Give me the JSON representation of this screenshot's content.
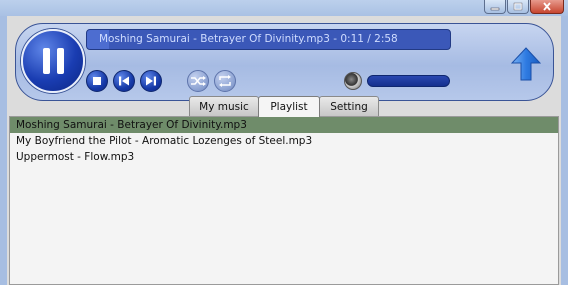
{
  "window": {
    "buttons": [
      "minimize",
      "maximize",
      "close"
    ]
  },
  "player": {
    "now_playing": "Moshing Samurai - Betrayer Of Divinity.mp3 - 0:11 / 2:58",
    "progress": 0.06,
    "state": "playing",
    "icons": {
      "play_pause": "pause-icon",
      "stop": "stop-icon",
      "previous": "previous-icon",
      "next": "next-icon",
      "shuffle": "shuffle-icon",
      "repeat": "repeat-icon",
      "volume": "volume-knob-icon",
      "collapse": "up-arrow-icon"
    },
    "volume": 1.0
  },
  "tabs": [
    {
      "label": "My music",
      "active": false
    },
    {
      "label": "Playlist",
      "active": true
    },
    {
      "label": "Setting",
      "active": false
    }
  ],
  "playlist": {
    "items": [
      {
        "label": "Moshing Samurai - Betrayer Of Divinity.mp3",
        "selected": true
      },
      {
        "label": "My Boyfriend the Pilot - Aromatic Lozenges of Steel.mp3",
        "selected": false
      },
      {
        "label": "Uppermost - Flow.mp3",
        "selected": false
      }
    ]
  },
  "colors": {
    "selection": "#6f8c6a",
    "accent_blue": "#1a3db2"
  }
}
